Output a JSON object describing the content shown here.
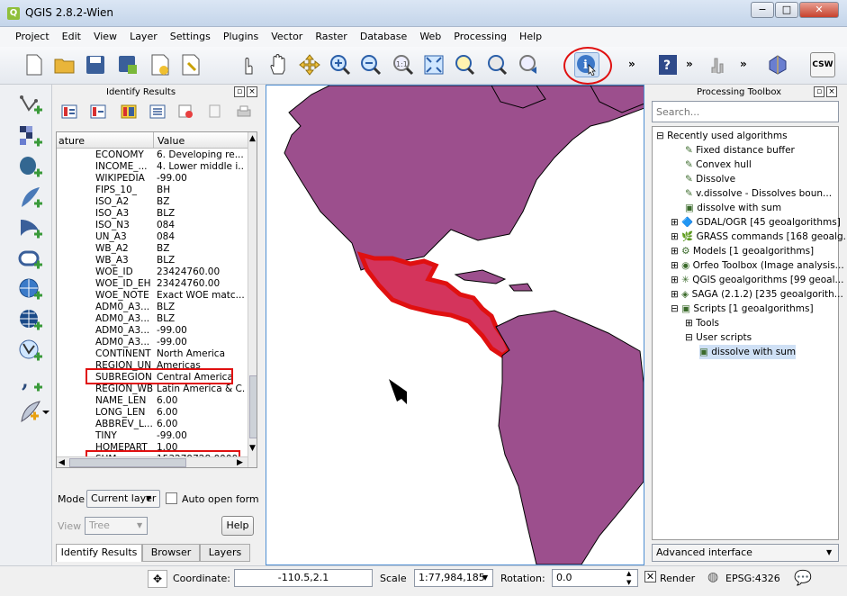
{
  "window": {
    "title": "QGIS 2.8.2-Wien",
    "min": "−",
    "max": "□",
    "close": "✕"
  },
  "menu": [
    "Project",
    "Edit",
    "View",
    "Layer",
    "Settings",
    "Plugins",
    "Vector",
    "Raster",
    "Database",
    "Web",
    "Processing",
    "Help"
  ],
  "toolbar": {
    "chevron": "»",
    "csw": "CSW"
  },
  "identify": {
    "title": "Identify Results",
    "col_feature": "ature",
    "col_value": "Value",
    "rows": [
      [
        "ECONOMY",
        "6. Developing re..."
      ],
      [
        "INCOME_...",
        "4. Lower middle i..."
      ],
      [
        "WIKIPEDIA",
        "-99.00"
      ],
      [
        "FIPS_10_",
        "BH"
      ],
      [
        "ISO_A2",
        "BZ"
      ],
      [
        "ISO_A3",
        "BLZ"
      ],
      [
        "ISO_N3",
        "084"
      ],
      [
        "UN_A3",
        "084"
      ],
      [
        "WB_A2",
        "BZ"
      ],
      [
        "WB_A3",
        "BLZ"
      ],
      [
        "WOE_ID",
        "23424760.00"
      ],
      [
        "WOE_ID_EH",
        "23424760.00"
      ],
      [
        "WOE_NOTE",
        "Exact WOE matc..."
      ],
      [
        "ADM0_A3...",
        "BLZ"
      ],
      [
        "ADM0_A3...",
        "BLZ"
      ],
      [
        "ADM0_A3...",
        "-99.00"
      ],
      [
        "ADM0_A3...",
        "-99.00"
      ],
      [
        "CONTINENT",
        "North America"
      ],
      [
        "REGION_UN",
        "Americas"
      ],
      [
        "SUBREGION",
        "Central America"
      ],
      [
        "REGION_WB",
        "Latin America & C..."
      ],
      [
        "NAME_LEN",
        "6.00"
      ],
      [
        "LONG_LEN",
        "6.00"
      ],
      [
        "ABBREV_L...",
        "6.00"
      ],
      [
        "TINY",
        "-99.00"
      ],
      [
        "HOMEPART",
        "1.00"
      ],
      [
        "SUM",
        "153279728.0000..."
      ]
    ],
    "mode_label": "Mode",
    "mode_value": "Current layer",
    "auto_open": "Auto open form",
    "view_label": "View",
    "view_value": "Tree",
    "help": "Help",
    "tabs": [
      "Identify Results",
      "Browser",
      "Layers"
    ]
  },
  "processing": {
    "title": "Processing Toolbox",
    "search_placeholder": "Search...",
    "tree": [
      {
        "label": "Recently used algorithms",
        "indent": 0,
        "exp": "⊟"
      },
      {
        "label": "Fixed distance buffer",
        "indent": 2,
        "exp": ""
      },
      {
        "label": "Convex hull",
        "indent": 2,
        "exp": ""
      },
      {
        "label": "Dissolve",
        "indent": 2,
        "exp": ""
      },
      {
        "label": "v.dissolve - Dissolves boun...",
        "indent": 2,
        "exp": ""
      },
      {
        "label": "dissolve with sum",
        "indent": 2,
        "exp": ""
      },
      {
        "label": "GDAL/OGR [45 geoalgorithms]",
        "indent": 1,
        "exp": "⊞"
      },
      {
        "label": "GRASS commands [168 geoalg...",
        "indent": 1,
        "exp": "⊞"
      },
      {
        "label": "Models [1 geoalgorithms]",
        "indent": 1,
        "exp": "⊞"
      },
      {
        "label": "Orfeo Toolbox (Image analysis...",
        "indent": 1,
        "exp": "⊞"
      },
      {
        "label": "QGIS geoalgorithms [99 geoal...",
        "indent": 1,
        "exp": "⊞"
      },
      {
        "label": "SAGA (2.1.2) [235 geoalgorith...",
        "indent": 1,
        "exp": "⊞"
      },
      {
        "label": "Scripts [1 geoalgorithms]",
        "indent": 1,
        "exp": "⊟"
      },
      {
        "label": "Tools",
        "indent": 2,
        "exp": "⊞"
      },
      {
        "label": "User scripts",
        "indent": 2,
        "exp": "⊟"
      },
      {
        "label": "dissolve with sum",
        "indent": 3,
        "exp": ""
      }
    ],
    "advanced": "Advanced interface"
  },
  "status": {
    "coordinate_label": "Coordinate:",
    "coordinate_value": "-110.5,2.1",
    "scale_label": "Scale",
    "scale_value": "1:77,984,185",
    "rotation_label": "Rotation:",
    "rotation_value": "0.0",
    "render": "Render",
    "epsg": "EPSG:4326"
  },
  "colors": {
    "land": "#9c4f8d",
    "selected": "#d4345c",
    "highlight": "#e01010"
  }
}
